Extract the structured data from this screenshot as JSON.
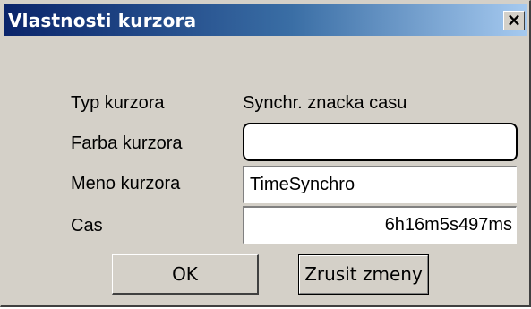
{
  "window": {
    "title": "Vlastnosti kurzora",
    "close_glyph": "×"
  },
  "form": {
    "type_label": "Typ kurzora",
    "type_value": "Synchr. znacka casu",
    "color_label": "Farba kurzora",
    "name_label": "Meno kurzora",
    "name_value": "TimeSynchro",
    "time_label": "Cas",
    "time_value": "6h16m5s497ms"
  },
  "buttons": {
    "ok_label": "OK",
    "cancel_label": "Zrusit zmeny"
  },
  "colors": {
    "titlebar_start": "#0a246a",
    "titlebar_end": "#a6caf0",
    "dialog_face": "#d4d0c8"
  }
}
